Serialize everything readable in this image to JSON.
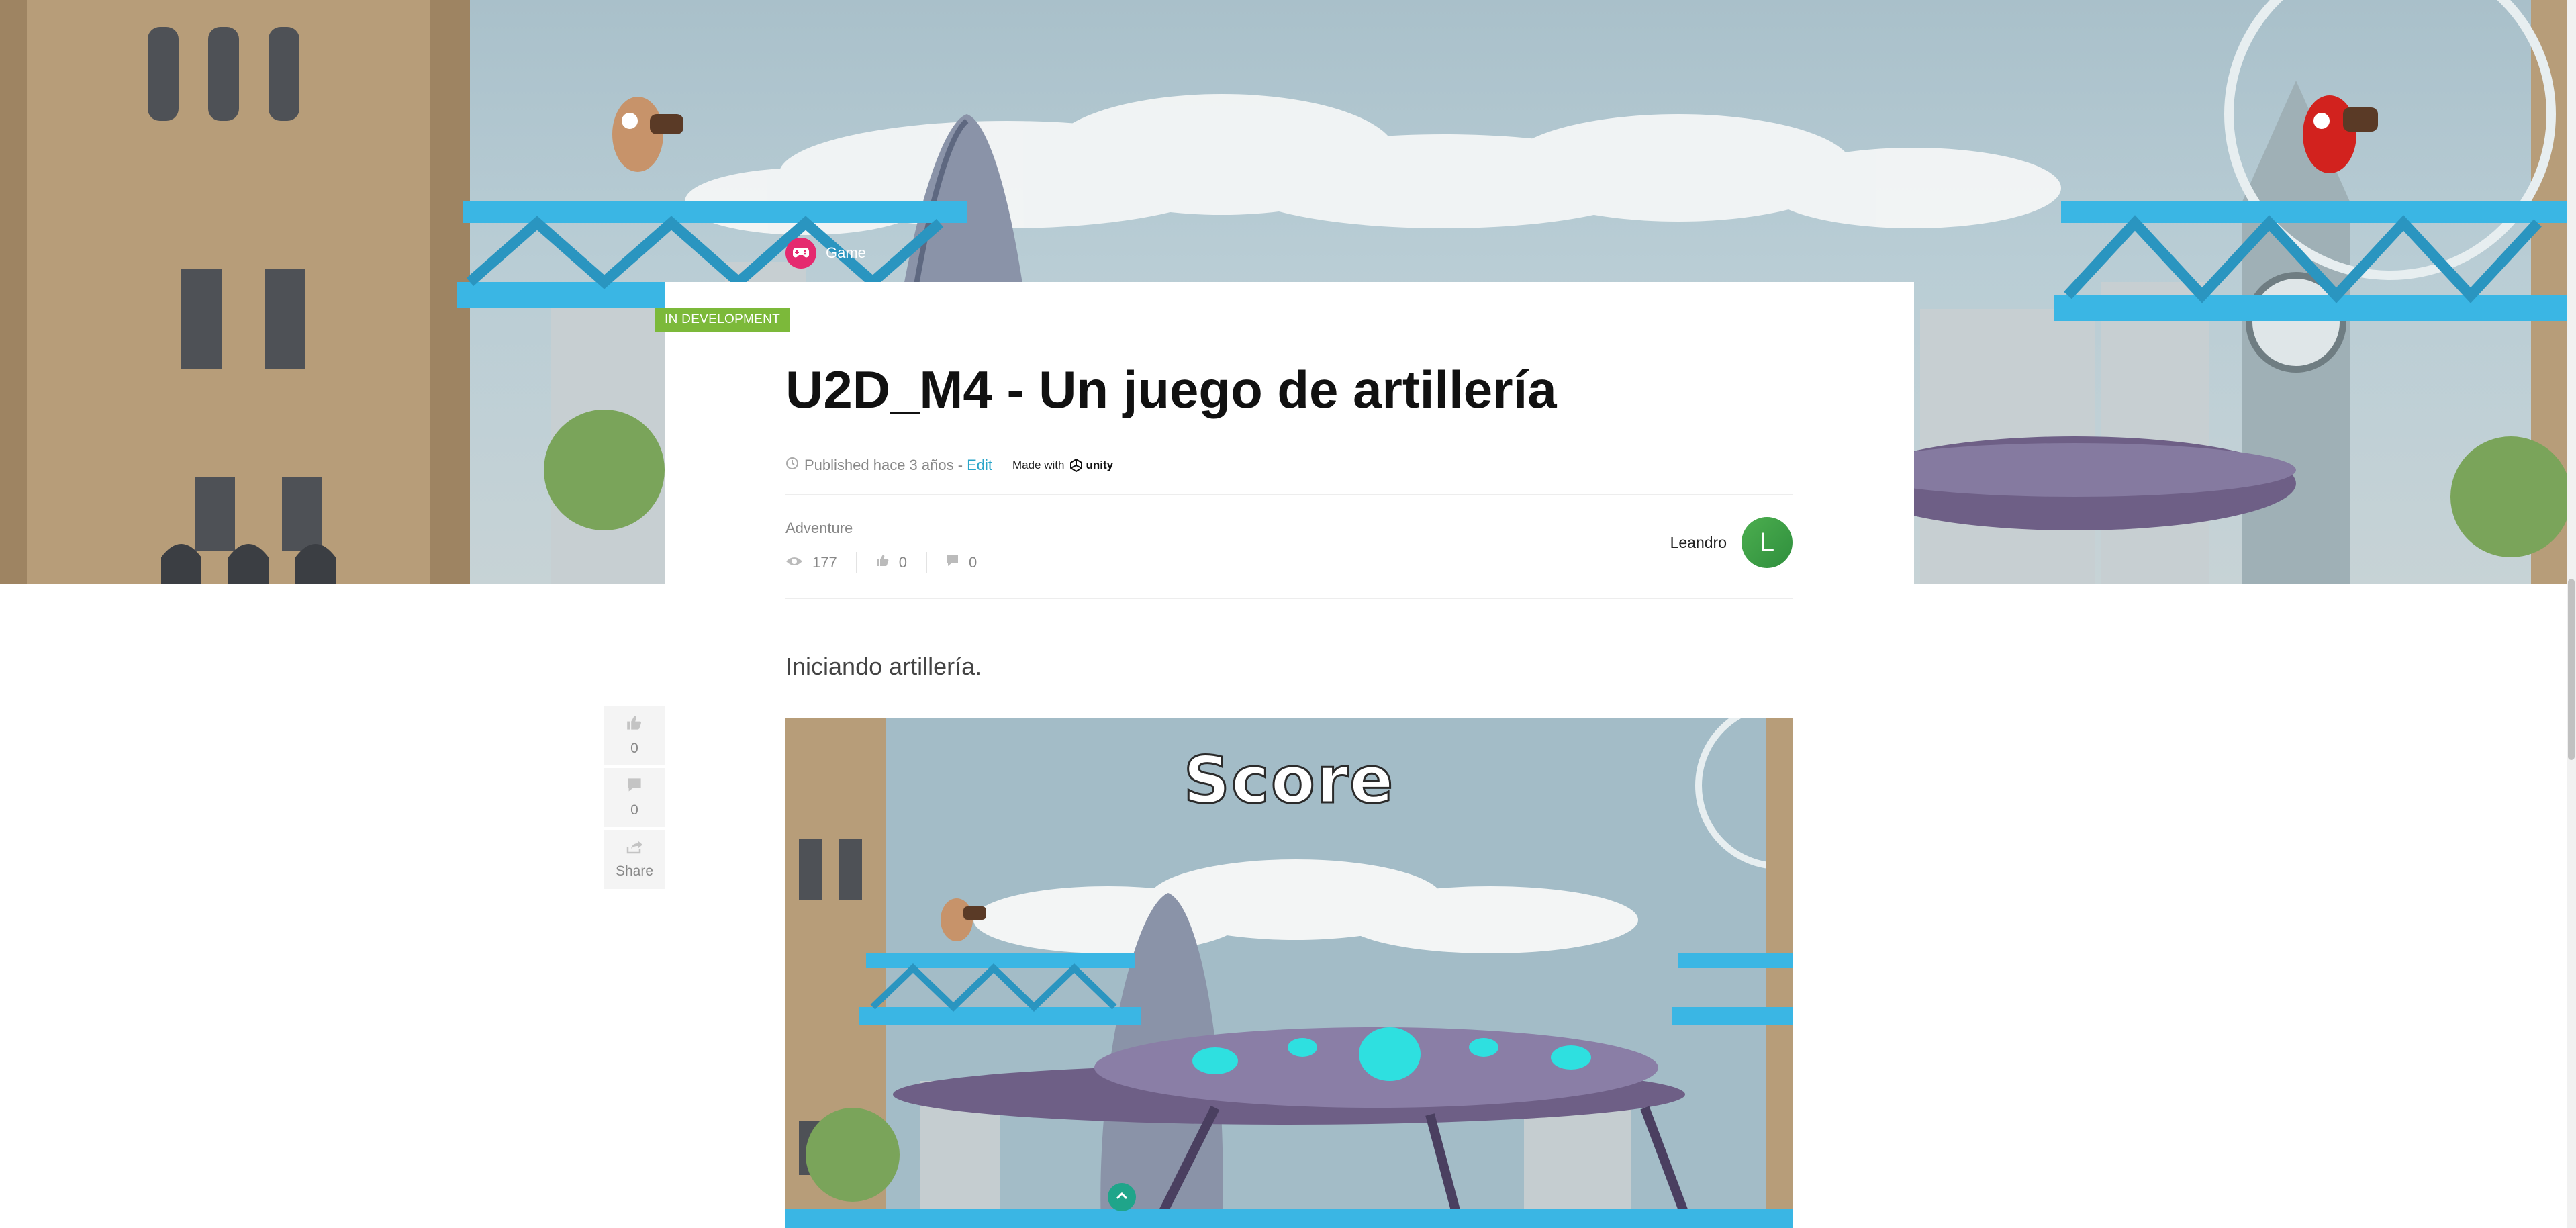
{
  "category": {
    "label": "Game",
    "icon": "gamepad-icon"
  },
  "status_badge": "IN DEVELOPMENT",
  "title": "U2D_M4  - Un juego de artillería",
  "meta": {
    "published": "Published hace 3 años - ",
    "edit": "Edit",
    "made_with": "Made with",
    "engine": "unity"
  },
  "genre": "Adventure",
  "stats": {
    "views": "177",
    "likes": "0",
    "comments": "0"
  },
  "author": {
    "name": "Leandro",
    "initial": "L"
  },
  "intro": "Iniciando artillería.",
  "side_actions": {
    "likes": "0",
    "comments": "0",
    "share": "Share"
  },
  "screenshot": {
    "score_text": "Score"
  },
  "colors": {
    "badge": "#7cb93a",
    "link": "#2aa5c9",
    "category": "#e52a6f",
    "avatar": "#4cae4f"
  }
}
